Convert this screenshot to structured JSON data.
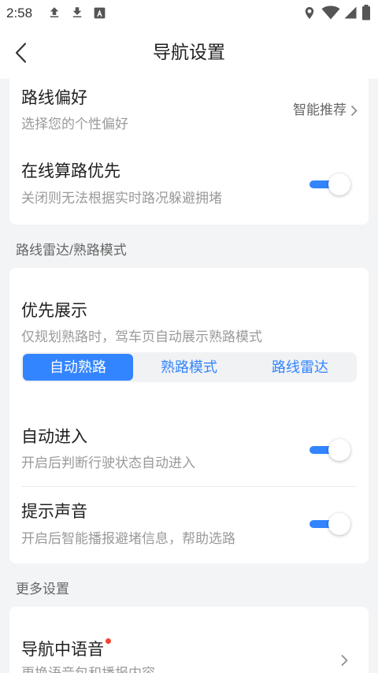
{
  "status_bar": {
    "time": "2:58",
    "left_icons": [
      "upload-icon",
      "download-icon",
      "a-box-icon"
    ],
    "right_icons": [
      "location-icon",
      "wifi-icon",
      "signal-icon",
      "battery-icon"
    ]
  },
  "header": {
    "back_icon": "chevron-left-icon",
    "title": "导航设置"
  },
  "colors": {
    "accent": "#3385ff",
    "background": "#f3f4f6",
    "card": "#ffffff",
    "badge": "#f5432f"
  },
  "route_card": {
    "preference": {
      "title": "路线偏好",
      "subtitle": "选择您的个性偏好",
      "value": "智能推荐",
      "icon": "chevron-right-icon"
    },
    "online_routing": {
      "title": "在线算路优先",
      "subtitle": "关闭则无法根据实时路况躲避拥堵",
      "enabled": true
    }
  },
  "radar_section": {
    "label": "路线雷达/熟路模式",
    "priority": {
      "title": "优先展示",
      "subtitle": "仅规划熟路时，驾车页自动展示熟路模式",
      "options": [
        "自动熟路",
        "熟路模式",
        "路线雷达"
      ],
      "selected_index": 0
    },
    "auto_enter": {
      "title": "自动进入",
      "subtitle": "开启后判断行驶状态自动进入",
      "enabled": true
    },
    "sound": {
      "title": "提示声音",
      "subtitle": "开启后智能播报避堵信息，帮助选路",
      "enabled": true
    }
  },
  "more_section": {
    "label": "更多设置",
    "voice": {
      "title": "导航中语音",
      "subtitle": "更换语音包和播报内容",
      "has_new_badge": true,
      "icon": "chevron-right-icon"
    }
  }
}
